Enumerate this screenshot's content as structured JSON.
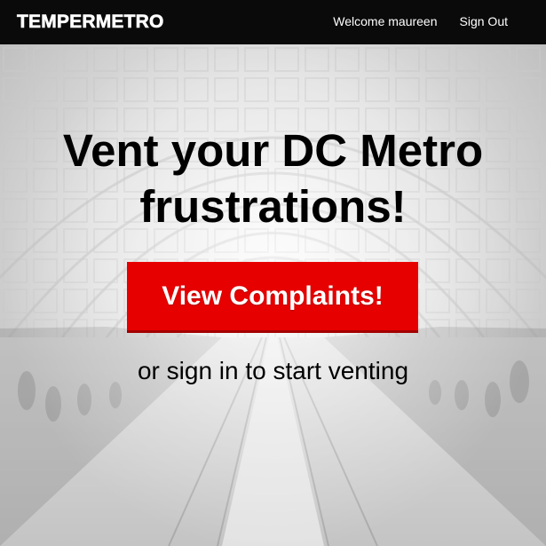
{
  "navbar": {
    "brand": "TEMPERMETRO",
    "welcome": "Welcome maureen",
    "sign_out": "Sign Out"
  },
  "hero": {
    "title_line1": "Vent your DC Metro",
    "title_line2": "frustrations!",
    "cta_label": "View Complaints!",
    "subtext": "or sign in to start venting"
  },
  "colors": {
    "navbar_bg": "#0a0a0a",
    "cta_bg": "#e60000",
    "cta_border": "#a30000",
    "title_text": "#000000"
  }
}
